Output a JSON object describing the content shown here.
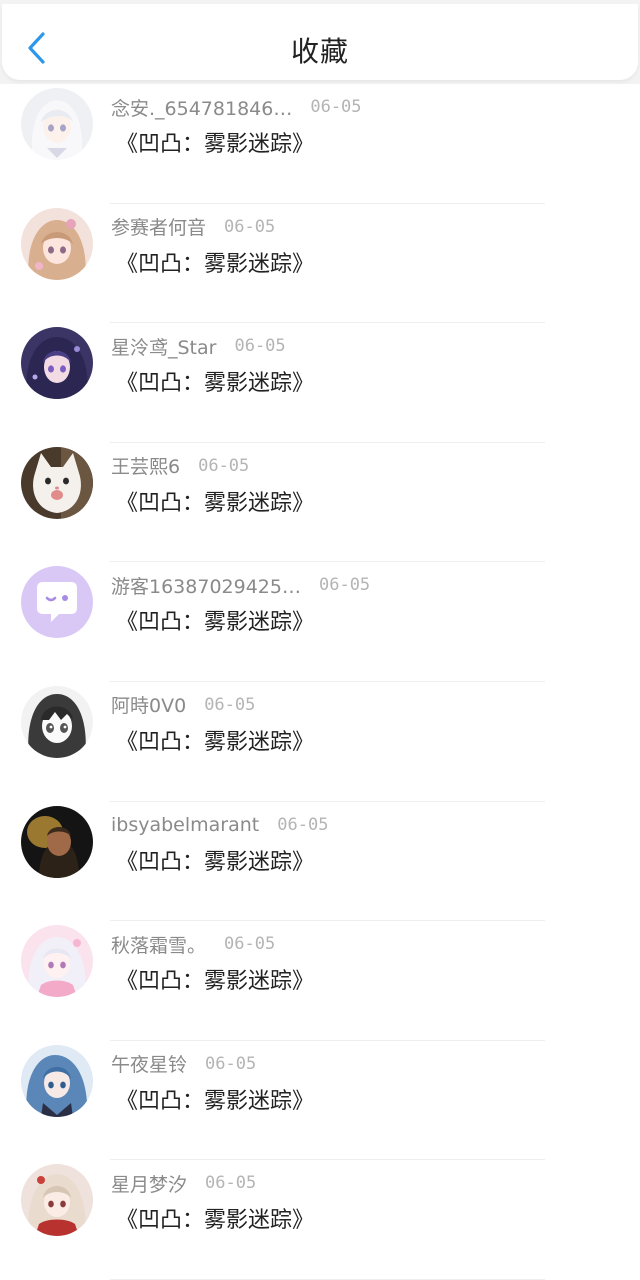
{
  "header": {
    "title": "收藏",
    "back_icon": "chevron-left-icon",
    "accent_color": "#2f97ea"
  },
  "items": [
    {
      "name": "念安._654781846…",
      "date": "06-05",
      "title": "《凹凸：雾影迷踪》",
      "avatar": "anime-girl-white-hair-avatar"
    },
    {
      "name": "参赛者何音",
      "date": "06-05",
      "title": "《凹凸：雾影迷踪》",
      "avatar": "anime-girl-blonde-avatar"
    },
    {
      "name": "星泠鸢_Star",
      "date": "06-05",
      "title": "《凹凸：雾影迷踪》",
      "avatar": "anime-girl-purple-hair-avatar"
    },
    {
      "name": "王芸熙6",
      "date": "06-05",
      "title": "《凹凸：雾影迷踪》",
      "avatar": "white-cat-avatar"
    },
    {
      "name": "游客16387029425…",
      "date": "06-05",
      "title": "《凹凸：雾影迷踪》",
      "avatar": "default-chat-bubble-avatar"
    },
    {
      "name": "阿時0V0",
      "date": "06-05",
      "title": "《凹凸：雾影迷踪》",
      "avatar": "manga-sketch-avatar"
    },
    {
      "name": "ibsyabelmarant",
      "date": "06-05",
      "title": "《凹凸：雾影迷踪》",
      "avatar": "dark-portrait-avatar"
    },
    {
      "name": "秋落霜雪。",
      "date": "06-05",
      "title": "《凹凸：雾影迷踪》",
      "avatar": "pink-anime-girl-avatar"
    },
    {
      "name": "午夜星铃",
      "date": "06-05",
      "title": "《凹凸：雾影迷踪》",
      "avatar": "blue-hair-anime-avatar"
    },
    {
      "name": "星月梦汐",
      "date": "06-05",
      "title": "《凹凸：雾影迷踪》",
      "avatar": "red-anime-girl-avatar"
    }
  ]
}
